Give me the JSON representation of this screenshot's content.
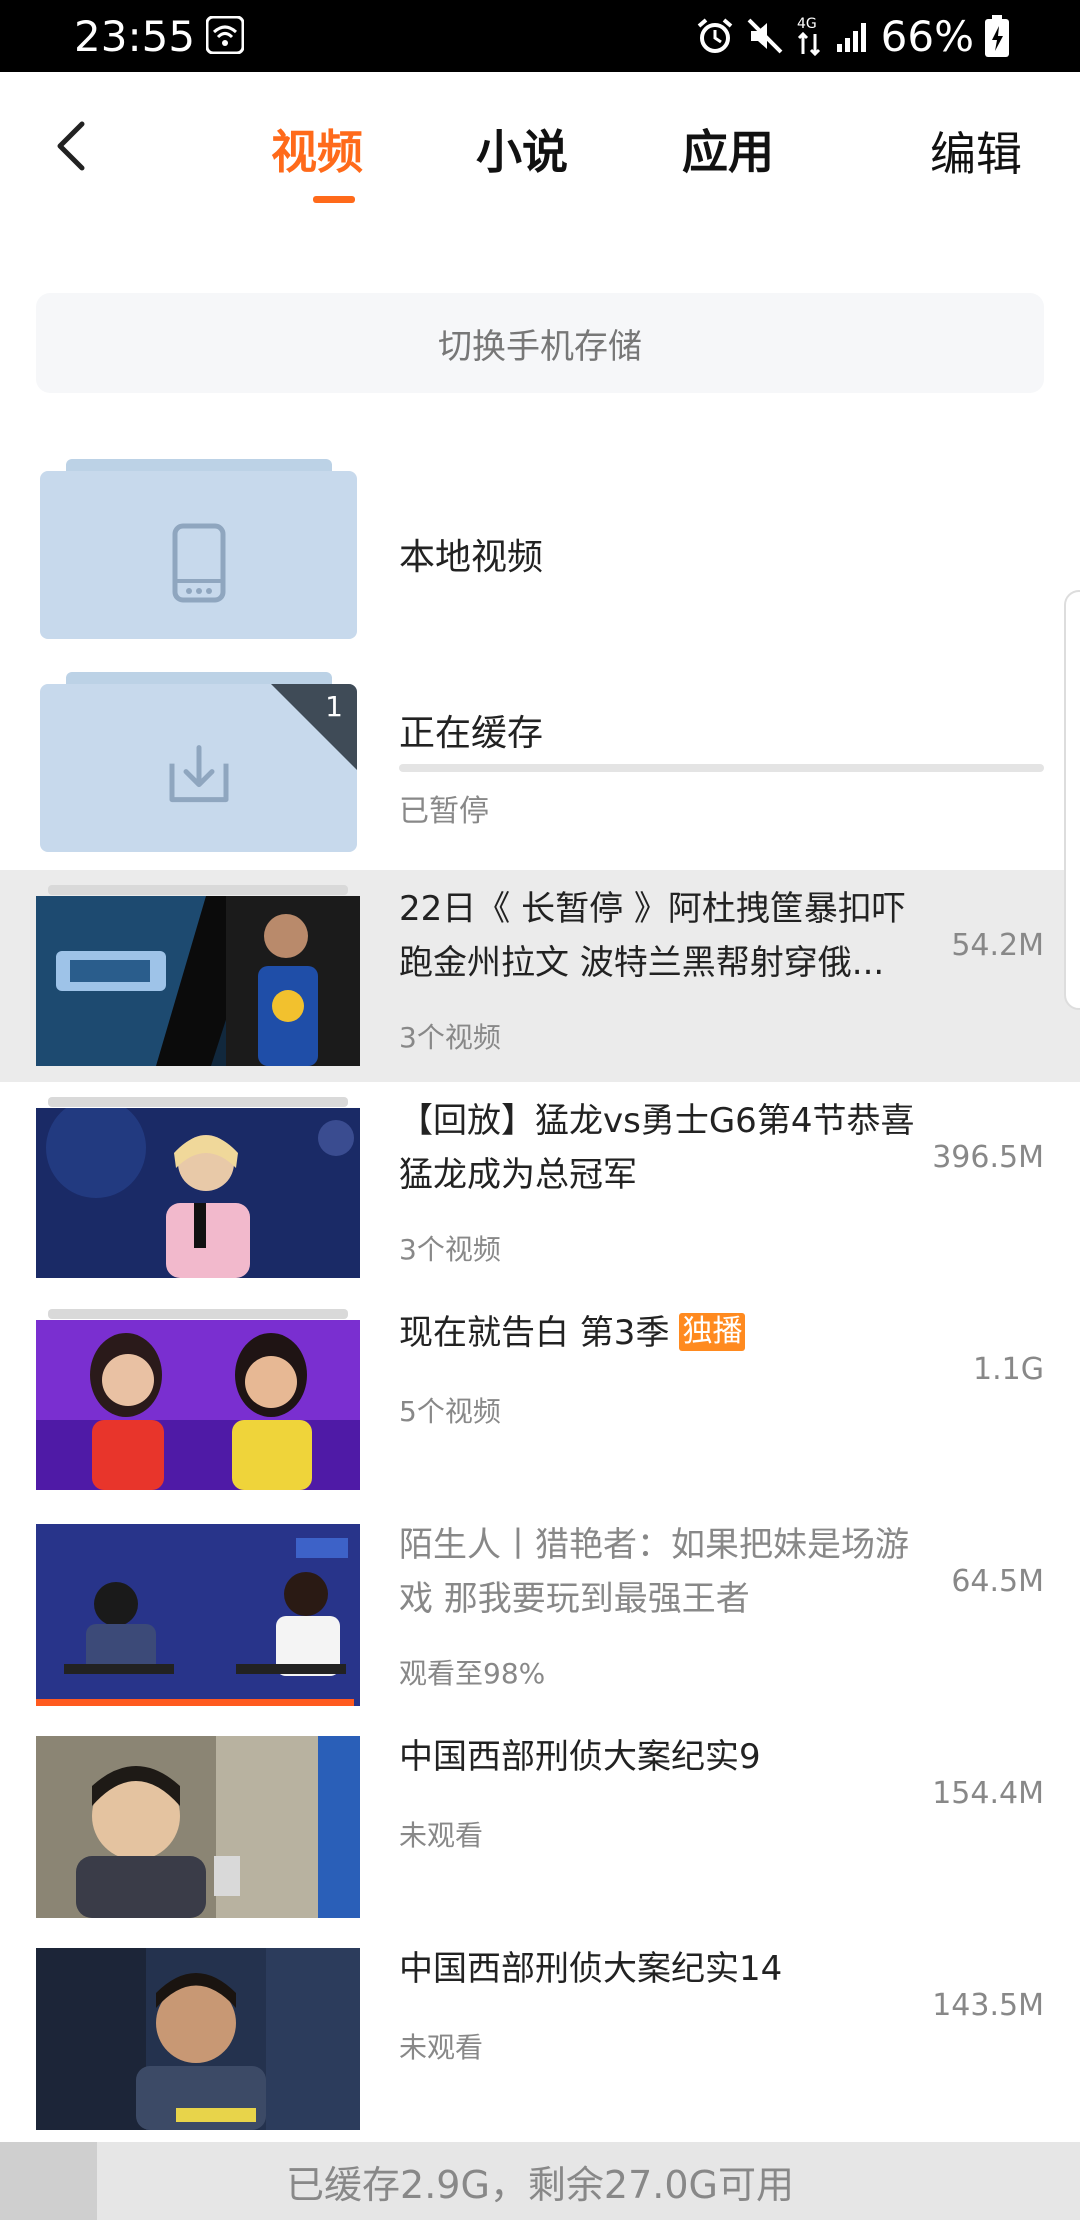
{
  "status_bar": {
    "time": "23:55",
    "battery_percent": "66%",
    "network_label": "4G"
  },
  "nav": {
    "tabs": [
      {
        "label": "视频",
        "active": true
      },
      {
        "label": "小说",
        "active": false
      },
      {
        "label": "应用",
        "active": false
      }
    ],
    "edit_label": "编辑"
  },
  "switch_storage_label": "切换手机存储",
  "local_videos": {
    "label": "本地视频"
  },
  "caching": {
    "label": "正在缓存",
    "status": "已暂停",
    "count": "1",
    "progress": 0
  },
  "videos": [
    {
      "title": "22日《 长暂停 》阿杜拽筐暴扣吓跑金州拉文 波特兰黑帮射穿俄...",
      "sub": "3个视频",
      "size": "54.2M",
      "highlight": true
    },
    {
      "title": "【回放】猛龙vs勇士G6第4节恭喜猛龙成为总冠军",
      "sub": "3个视频",
      "size": "396.5M"
    },
    {
      "title": "现在就告白 第3季",
      "badge": "独播",
      "sub": "5个视频",
      "size": "1.1G"
    },
    {
      "title": "陌生人丨猎艳者：如果把妹是场游戏 那我要玩到最强王者",
      "sub": "观看至98%",
      "size": "64.5M",
      "watched_fraction": 0.98
    },
    {
      "title": "中国西部刑侦大案纪实9",
      "sub": "未观看",
      "size": "154.4M"
    },
    {
      "title": "中国西部刑侦大案纪实14",
      "sub": "未观看",
      "size": "143.5M"
    }
  ],
  "footer": {
    "storage_text": "已缓存2.9G，剩余27.0G可用",
    "used_fraction": 0.09
  },
  "colors": {
    "accent": "#ff6a1a",
    "badge": "#ff8a1f",
    "folder": "#c7d9ec"
  }
}
